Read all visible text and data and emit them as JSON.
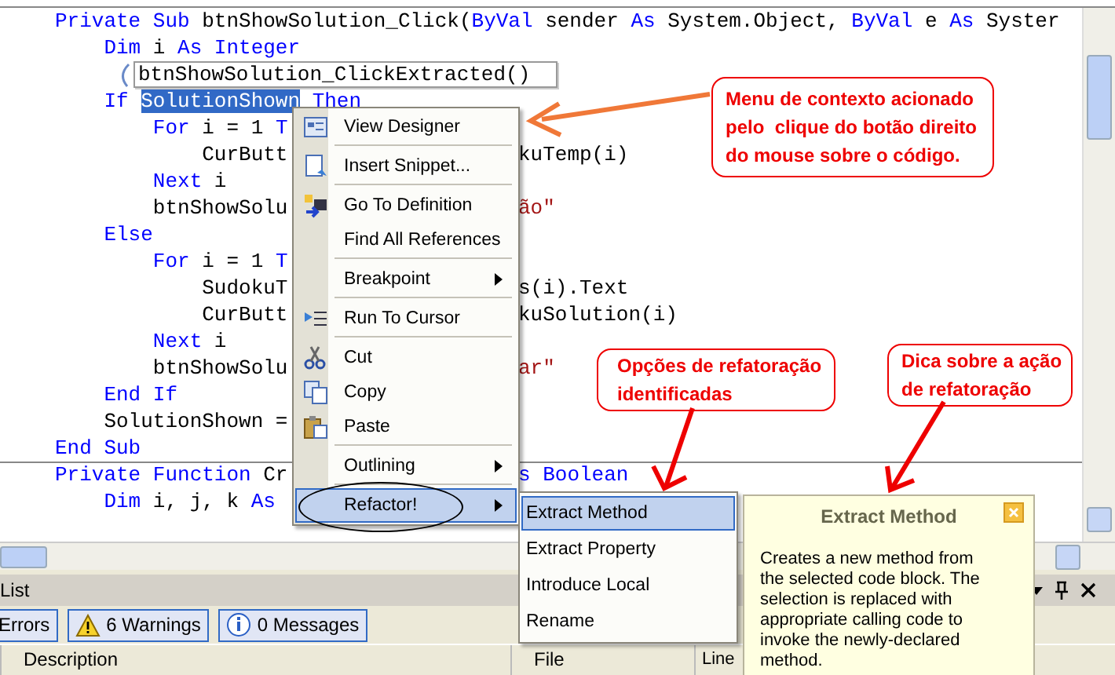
{
  "editor": {
    "lines": [
      {
        "kind": "code",
        "left": [
          {
            "t": "Private Sub",
            "kind": "keyword"
          },
          {
            "t": " btnShowSolution_Click(",
            "kind": "plain"
          },
          {
            "t": "ByVal",
            "kind": "keyword"
          },
          {
            "t": " sender ",
            "kind": "plain"
          },
          {
            "t": "As",
            "kind": "keyword"
          },
          {
            "t": " System.Object, ",
            "kind": "plain"
          },
          {
            "t": "ByVal",
            "kind": "keyword"
          },
          {
            "t": " e ",
            "kind": "plain"
          },
          {
            "t": "As",
            "kind": "keyword"
          },
          {
            "t": " Syster",
            "kind": "plain"
          }
        ]
      },
      {
        "kind": "code",
        "left": [
          {
            "t": "    Dim",
            "kind": "keyword"
          },
          {
            "t": " i ",
            "kind": "plain"
          },
          {
            "t": "As Integer",
            "kind": "keyword"
          }
        ]
      },
      {
        "kind": "tag",
        "text": "btnShowSolution_ClickExtracted()"
      },
      {
        "kind": "code",
        "left": [
          {
            "t": "    If ",
            "kind": "keyword"
          },
          {
            "t": "SolutionShown",
            "kind": "selected"
          },
          {
            "t": " Then",
            "kind": "keyword"
          }
        ]
      },
      {
        "kind": "code",
        "left": [
          {
            "t": "        For",
            "kind": "keyword"
          },
          {
            "t": " i = 1 ",
            "kind": "plain"
          },
          {
            "t": "T",
            "kind": "keyword"
          }
        ]
      },
      {
        "kind": "code",
        "left": [
          {
            "t": "            CurButt",
            "kind": "plain"
          }
        ],
        "right": [
          {
            "t": "kuTemp(i)",
            "kind": "plain"
          }
        ]
      },
      {
        "kind": "code",
        "left": [
          {
            "t": "        Next",
            "kind": "keyword"
          },
          {
            "t": " i",
            "kind": "plain"
          }
        ]
      },
      {
        "kind": "code",
        "left": [
          {
            "t": "        btnShowSolu",
            "kind": "plain"
          }
        ],
        "right": [
          {
            "t": "ão\"",
            "kind": "string"
          }
        ]
      },
      {
        "kind": "code",
        "left": [
          {
            "t": "    Else",
            "kind": "keyword"
          }
        ]
      },
      {
        "kind": "code",
        "left": [
          {
            "t": "        For",
            "kind": "keyword"
          },
          {
            "t": " i = 1 ",
            "kind": "plain"
          },
          {
            "t": "T",
            "kind": "keyword"
          }
        ]
      },
      {
        "kind": "code",
        "left": [
          {
            "t": "            SudokuT",
            "kind": "plain"
          }
        ],
        "right": [
          {
            "t": "s(i).Text",
            "kind": "plain"
          }
        ]
      },
      {
        "kind": "code",
        "left": [
          {
            "t": "            CurButt",
            "kind": "plain"
          }
        ],
        "right": [
          {
            "t": "kuSolution(i)",
            "kind": "plain"
          }
        ]
      },
      {
        "kind": "code",
        "left": [
          {
            "t": "        Next",
            "kind": "keyword"
          },
          {
            "t": " i",
            "kind": "plain"
          }
        ]
      },
      {
        "kind": "code",
        "left": [
          {
            "t": "        btnShowSolu",
            "kind": "plain"
          }
        ],
        "right": [
          {
            "t": "ar\"",
            "kind": "string"
          }
        ]
      },
      {
        "kind": "code",
        "left": [
          {
            "t": "    End If",
            "kind": "keyword"
          }
        ]
      },
      {
        "kind": "code",
        "left": [
          {
            "t": "    SolutionShown =",
            "kind": "plain"
          }
        ]
      },
      {
        "kind": "code",
        "left": [
          {
            "t": "End Sub",
            "kind": "keyword"
          }
        ]
      },
      {
        "kind": "divider"
      },
      {
        "kind": "code",
        "left": [
          {
            "t": "Private Function",
            "kind": "keyword"
          },
          {
            "t": " Cr",
            "kind": "plain"
          }
        ],
        "right": [
          {
            "t": "s Boolean",
            "kind": "keyword"
          }
        ]
      },
      {
        "kind": "code",
        "left": [
          {
            "t": "    Dim",
            "kind": "keyword"
          },
          {
            "t": " i, j, k ",
            "kind": "plain"
          },
          {
            "t": "As",
            "kind": "keyword"
          }
        ]
      }
    ]
  },
  "context_menu": {
    "items": [
      {
        "label": "View Designer",
        "submenu": false,
        "selected": false,
        "separator_after": true
      },
      {
        "label": "Insert Snippet...",
        "submenu": false,
        "selected": false,
        "separator_after": true
      },
      {
        "label": "Go To Definition",
        "submenu": false,
        "selected": false,
        "separator_after": false
      },
      {
        "label": "Find All References",
        "submenu": false,
        "selected": false,
        "separator_after": true
      },
      {
        "label": "Breakpoint",
        "submenu": true,
        "selected": false,
        "separator_after": true
      },
      {
        "label": "Run To Cursor",
        "submenu": false,
        "selected": false,
        "separator_after": true
      },
      {
        "label": "Cut",
        "submenu": false,
        "selected": false,
        "separator_after": false
      },
      {
        "label": "Copy",
        "submenu": false,
        "selected": false,
        "separator_after": false
      },
      {
        "label": "Paste",
        "submenu": false,
        "selected": false,
        "separator_after": true
      },
      {
        "label": "Outlining",
        "submenu": true,
        "selected": false,
        "separator_after": true
      },
      {
        "label": "Refactor!",
        "submenu": true,
        "selected": true,
        "separator_after": false
      }
    ]
  },
  "refactor_submenu": {
    "items": [
      {
        "label": "Extract Method",
        "selected": true
      },
      {
        "label": "Extract Property",
        "selected": false
      },
      {
        "label": "Introduce Local",
        "selected": false
      },
      {
        "label": "Rename",
        "selected": false
      }
    ]
  },
  "tooltip": {
    "title": "Extract Method",
    "text": "Creates a new method from the selected code block. The selection is replaced with appropriate calling code to invoke the newly-declared method."
  },
  "callouts": [
    {
      "text": "Menu de contexto acionado\npelo  clique do botão direito\ndo mouse sobre o código."
    },
    {
      "text": "Opções de refatoração\nidentificadas"
    },
    {
      "text": "Dica sobre a ação\nde refatoração"
    }
  ],
  "error_list": {
    "title": "List",
    "filters": [
      {
        "label": "Errors",
        "selected": true
      },
      {
        "label": "6 Warnings",
        "selected": true
      },
      {
        "label": "0 Messages",
        "selected": true
      }
    ],
    "columns": [
      "Description",
      "File",
      "Line"
    ]
  }
}
